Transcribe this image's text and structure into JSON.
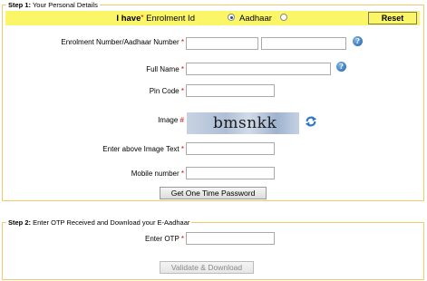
{
  "step1": {
    "legend_step": "Step 1:",
    "legend_text": "Your Personal Details",
    "ihave": {
      "label": "I have",
      "required_mark": "*",
      "option_enrolment": "Enrolment Id",
      "option_aadhaar": "Aadhaar",
      "selected": "Enrolment Id"
    },
    "reset_label": "Reset",
    "fields": {
      "enrolment_label": "Enrolment Number/Aadhaar Number",
      "fullname_label": "Full Name",
      "pincode_label": "Pin Code",
      "image_label": "Image",
      "image_mark": "#",
      "image_text_label": "Enter above Image Text",
      "mobile_label": "Mobile number",
      "required_mark": "*"
    },
    "captcha_text": "bmsnkk",
    "otp_button": "Get One Time Password"
  },
  "step2": {
    "legend_step": "Step 2:",
    "legend_text": "Enter OTP Received and Download your E-Aadhaar",
    "otp_label": "Enter OTP",
    "required_mark": "*",
    "validate_button": "Validate & Download"
  },
  "colors": {
    "border": "#f3c86a",
    "highlight": "#fbf568",
    "required": "#dd0000"
  },
  "icons": [
    "info-icon",
    "refresh-icon"
  ]
}
